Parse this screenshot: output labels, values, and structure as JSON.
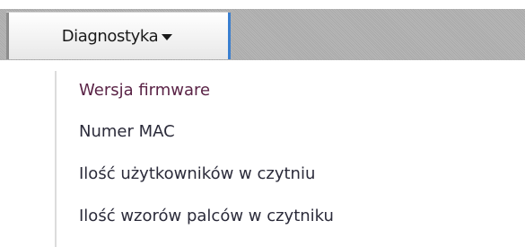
{
  "menu": {
    "label": "Diagnostyka",
    "caret_icon": "caret-down-icon"
  },
  "dropdown": {
    "items": [
      {
        "label": "Wersja firmware"
      },
      {
        "label": "Numer MAC"
      },
      {
        "label": "Ilość użytkowników w czytniu"
      },
      {
        "label": "Ilość wzorów palców w czytniku"
      }
    ]
  }
}
